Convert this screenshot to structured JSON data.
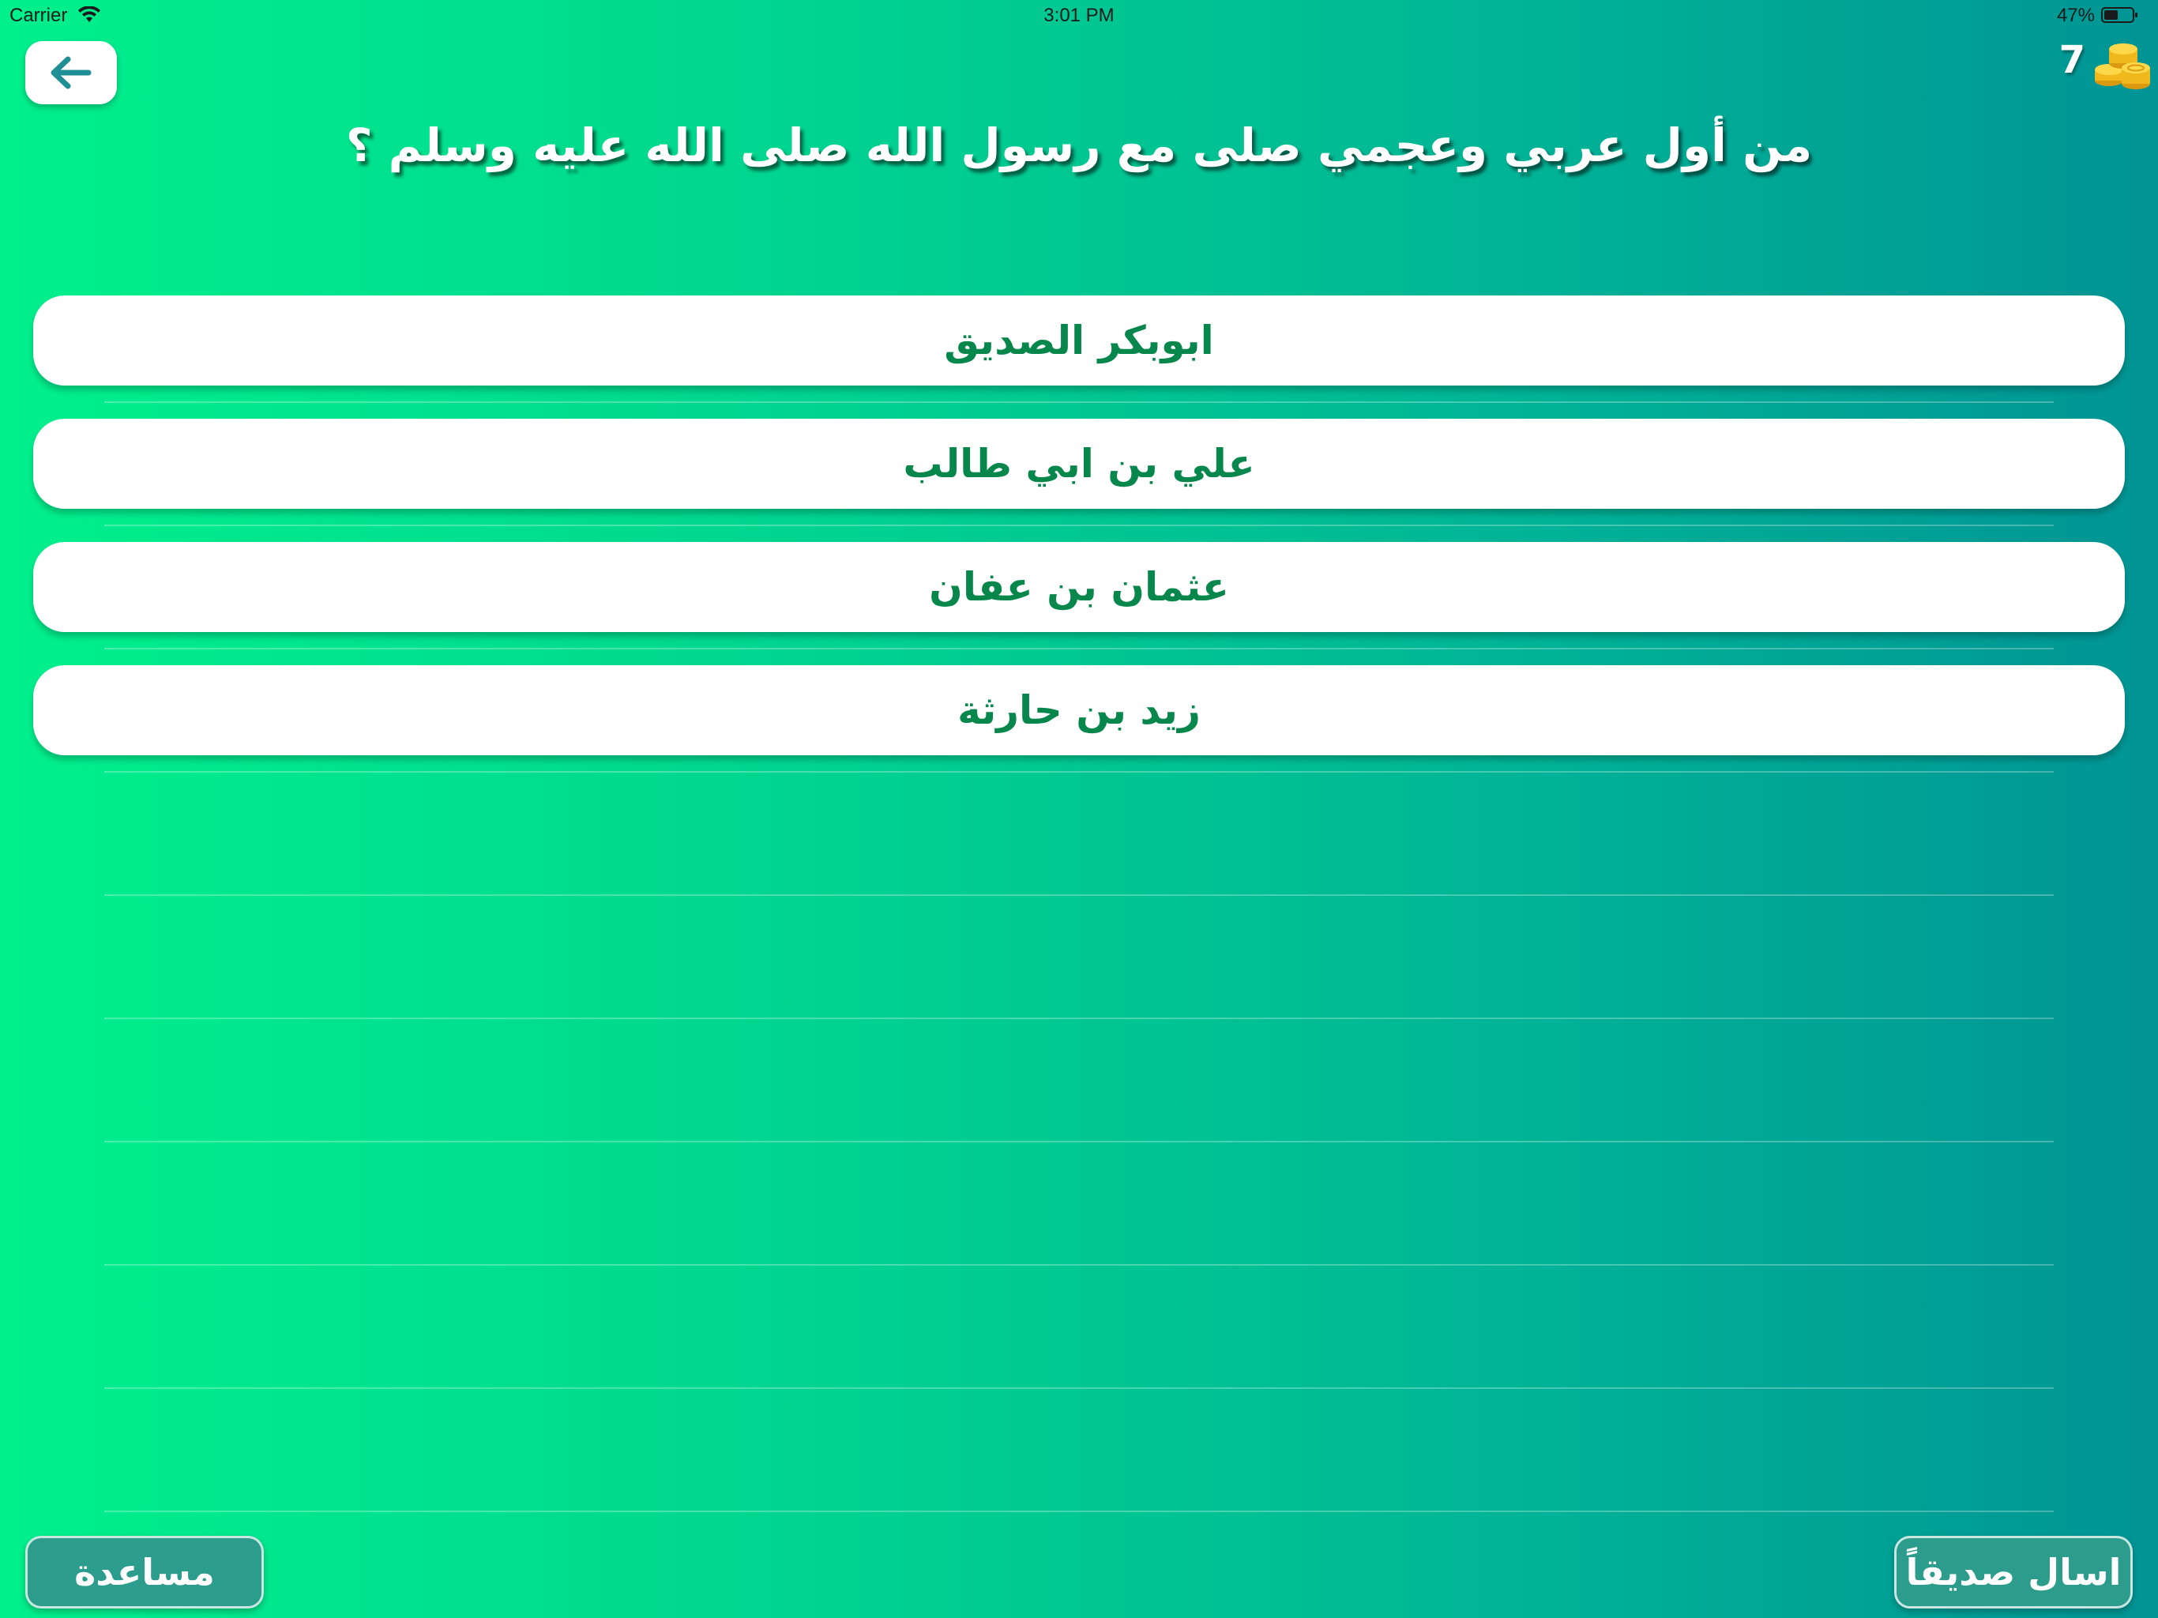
{
  "status_bar": {
    "carrier": "Carrier",
    "time": "3:01 PM",
    "battery": "47%"
  },
  "header": {
    "coins": "7",
    "back_icon": "arrow-left-icon",
    "coins_icon": "gold-coins-icon"
  },
  "question": {
    "text": "من أول عربي وعجمي صلى مع رسول الله صلى الله عليه وسلم ؟"
  },
  "answers": [
    {
      "label": "ابوبكر الصديق"
    },
    {
      "label": "علي بن ابي طالب"
    },
    {
      "label": "عثمان بن عفان"
    },
    {
      "label": "زيد بن حارثة"
    }
  ],
  "footer": {
    "help_label": "مساعدة",
    "ask_friend_label": "اسال صديقاً"
  },
  "colors": {
    "gradient_start": "#00f08c",
    "gradient_end": "#009494",
    "answer_text": "#07874c",
    "button_fill": "#2c9c8c",
    "back_arrow": "#1f8f95"
  }
}
